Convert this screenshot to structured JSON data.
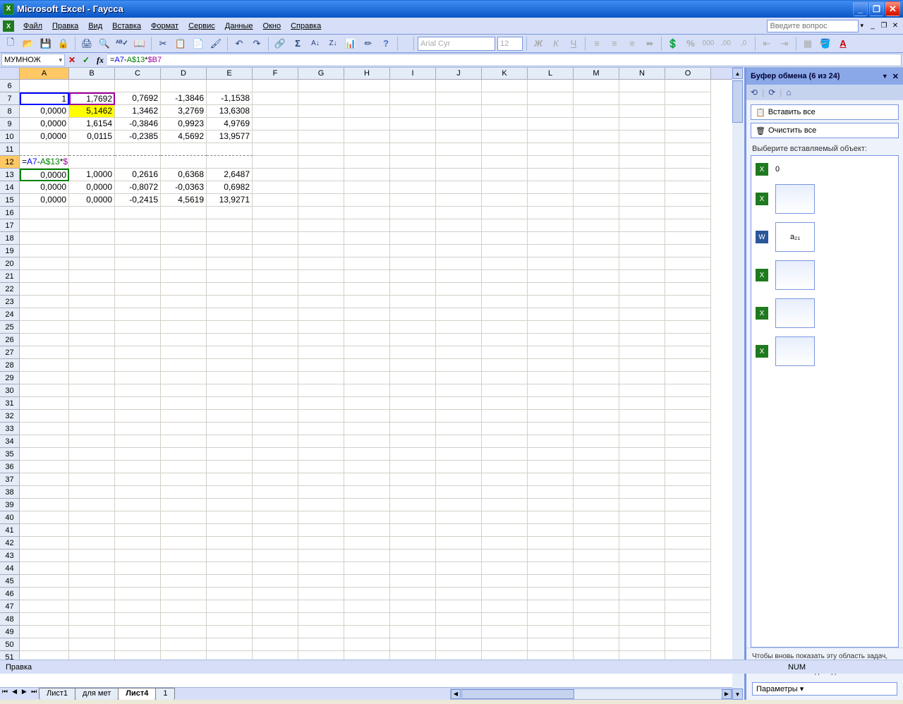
{
  "window": {
    "title": "Microsoft Excel - Гаусса"
  },
  "menubar": {
    "items": [
      "Файл",
      "Правка",
      "Вид",
      "Вставка",
      "Формат",
      "Сервис",
      "Данные",
      "Окно",
      "Справка"
    ],
    "help_placeholder": "Введите вопрос"
  },
  "toolbar": {
    "font_name": "Arial Cyr",
    "font_size": "12"
  },
  "formulabar": {
    "namebox": "МУМНОЖ",
    "formula_plain": "=A7-A$13*$B7",
    "parts": {
      "prefix": "=",
      "ref1": "A7",
      "op1": "-",
      "ref2": "A$13",
      "op2": "*",
      "ref3": "$B7"
    }
  },
  "columns": [
    "A",
    "B",
    "C",
    "D",
    "E",
    "F",
    "G",
    "H",
    "I",
    "J",
    "K",
    "L",
    "M",
    "N",
    "O"
  ],
  "row_start": 6,
  "row_end": 51,
  "editing_cell": {
    "row": 12,
    "col": "A"
  },
  "cells": {
    "A7": "1",
    "B7": "1,7692",
    "C7": "0,7692",
    "D7": "-1,3846",
    "E7": "-1,1538",
    "A8": "0,0000",
    "B8": "5,1462",
    "C8": "1,3462",
    "D8": "3,2769",
    "E8": "13,6308",
    "A9": "0,0000",
    "B9": "1,6154",
    "C9": "-0,3846",
    "D9": "0,9923",
    "E9": "4,9769",
    "A10": "0,0000",
    "B10": "0,0115",
    "C10": "-0,2385",
    "D10": "4,5692",
    "E10": "13,9577",
    "A13": "0,0000",
    "B13": "1,0000",
    "C13": "0,2616",
    "D13": "0,6368",
    "E13": "2,6487",
    "A14": "0,0000",
    "B14": "0,0000",
    "C14": "-0,8072",
    "D14": "-0,0363",
    "E14": "0,6982",
    "A15": "0,0000",
    "B15": "0,0000",
    "C15": "-0,2415",
    "D15": "4,5619",
    "E15": "13,9271"
  },
  "tabs": {
    "nav": [
      "⏮",
      "◀",
      "▶",
      "⏭"
    ],
    "sheets": [
      "Лист1",
      "для мет",
      "Лист4",
      "1"
    ],
    "active": "Лист4"
  },
  "taskpane": {
    "title": "Буфер обмена (6 из 24)",
    "paste_all": "Вставить все",
    "clear_all": "Очистить все",
    "choose_label": "Выберите вставляемый объект:",
    "item0_label": "0",
    "item2_label": "a₂₁",
    "footer": "Чтобы вновь показать эту область задач, выберите в меню \"Правка\" пункт \"Буфер обмена Office\" или дважды нажмите Ctrl+C.",
    "params": "Параметры ▾"
  },
  "statusbar": {
    "mode": "Правка",
    "num": "NUM"
  }
}
